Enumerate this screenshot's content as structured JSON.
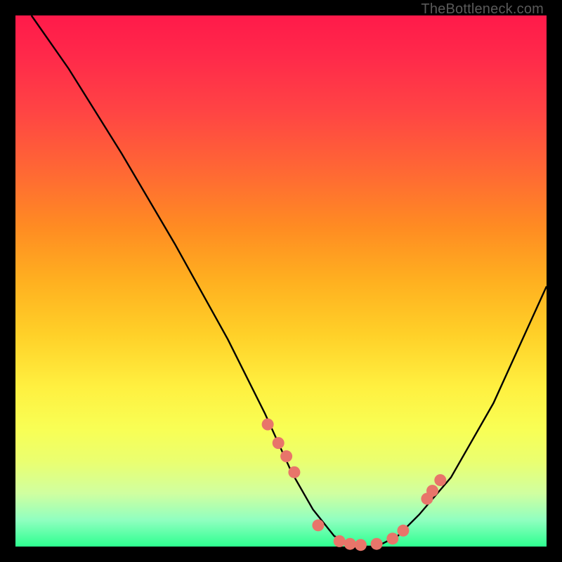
{
  "watermark": "TheBottleneck.com",
  "colors": {
    "background": "#000000",
    "gradient_top": "#ff1a4a",
    "gradient_bottom": "#2dff90",
    "curve": "#000000",
    "points": "#e8756a"
  },
  "chart_data": {
    "type": "line",
    "title": "",
    "xlabel": "",
    "ylabel": "",
    "xlim": [
      0,
      100
    ],
    "ylim": [
      0,
      100
    ],
    "curve": {
      "x": [
        3,
        10,
        20,
        30,
        40,
        47,
        52,
        56,
        60,
        64,
        68,
        72,
        76,
        82,
        90,
        100
      ],
      "y": [
        100,
        90,
        74,
        57,
        39,
        25,
        14,
        7,
        2,
        0,
        0,
        2,
        6,
        13,
        27,
        49
      ]
    },
    "series": [
      {
        "name": "highlight-points",
        "x": [
          47.5,
          49.5,
          51.0,
          52.5,
          57.0,
          61.0,
          63.0,
          65.0,
          68.0,
          71.0,
          73.0,
          77.5,
          78.5,
          80.0
        ],
        "y": [
          23.0,
          19.5,
          17.0,
          14.0,
          4.0,
          1.0,
          0.5,
          0.3,
          0.5,
          1.5,
          3.0,
          9.0,
          10.5,
          12.5
        ]
      }
    ]
  }
}
